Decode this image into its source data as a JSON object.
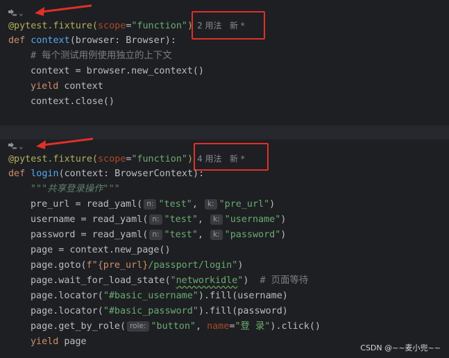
{
  "block1": {
    "deco": "@pytest.fixture(",
    "param_name": "scope",
    "eq": "=",
    "scope_val": "\"function\"",
    "close": ")",
    "usage": "2 用法   新 *",
    "def_kw": "def ",
    "fn_name": "context",
    "signature": "(browser: Browser):",
    "comment": "# 每个测试用例使用独立的上下文",
    "line_new_context": "context = browser.new_context()",
    "yield_kw": "yield",
    "yield_rest": " context",
    "line_close": "context.close()"
  },
  "block2": {
    "deco": "@pytest.fixture(",
    "param_name": "scope",
    "eq": "=",
    "scope_val": "\"function\"",
    "close": ")",
    "usage": "4 用法   新 *",
    "def_kw": "def ",
    "fn_name": "login",
    "signature": "(context: BrowserContext):",
    "docstring": "\"\"\"共享登录操作\"\"\"",
    "pre_url": {
      "left": "pre_url = read_yaml(",
      "hint_n": "n:",
      "arg1": "\"test\"",
      "comma": ", ",
      "hint_k": "k:",
      "arg2": "\"pre_url\"",
      "right": ")"
    },
    "username": {
      "left": "username = read_yaml(",
      "hint_n": "n:",
      "arg1": "\"test\"",
      "comma": ", ",
      "hint_k": "k:",
      "arg2": "\"username\"",
      "right": ")"
    },
    "password": {
      "left": "password = read_yaml(",
      "hint_n": "n:",
      "arg1": "\"test\"",
      "comma": ", ",
      "hint_k": "k:",
      "arg2": "\"password\"",
      "right": ")"
    },
    "line_new_page": "page = context.new_page()",
    "goto": {
      "left": "page.goto(",
      "fstr_open": "f\"",
      "interp": "{pre_url}",
      "fstr_rest": "/passport/login\"",
      "right": ")"
    },
    "wait": {
      "left": "page.wait_for_load_state(",
      "q1": "\"",
      "arg": "networkidle",
      "q2": "\"",
      "right": ")",
      "comment": "  # 页面等待"
    },
    "locator_user": {
      "left": "page.locator(",
      "arg": "\"#basic_username\"",
      "right": ").fill(username)"
    },
    "locator_pass": {
      "left": "page.locator(",
      "arg": "\"#basic_password\"",
      "right": ").fill(password)"
    },
    "role": {
      "left": "page.get_by_role(",
      "hint_role": "role:",
      "arg1": "\"button\"",
      "comma": ", ",
      "kw_name": "name",
      "eq": "=",
      "arg2": "\"登 录\"",
      "right": ").click()"
    },
    "yield_kw": "yield",
    "yield_rest": " page"
  },
  "watermark": "CSDN @~~麦小兜~~",
  "colors": {
    "background": "#1e1f22",
    "annotation_red": "#e0302a",
    "keyword": "#cf8e6d",
    "function": "#56a8f5",
    "string": "#6aab73",
    "decorator": "#b3ae60"
  },
  "icons": {
    "gutter": "fixture-gutter-icon",
    "arrow": "red-annotation-arrow"
  }
}
